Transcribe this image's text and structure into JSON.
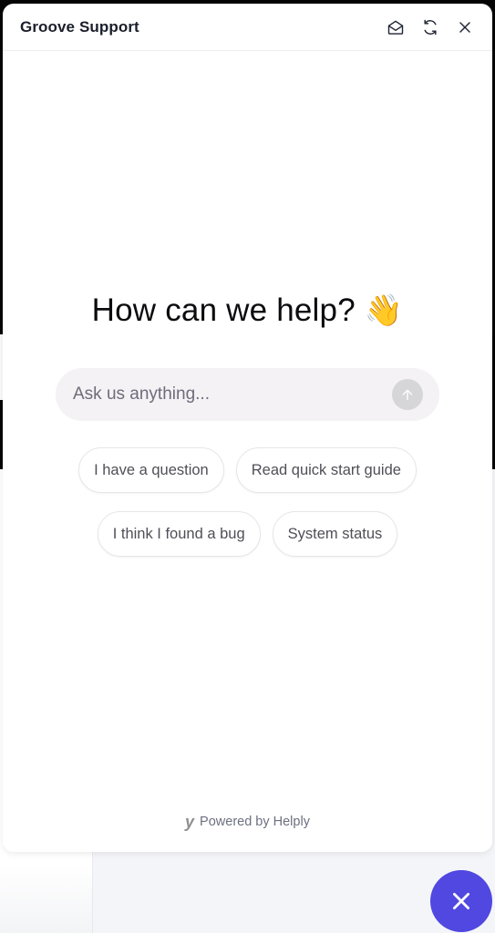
{
  "widget": {
    "title": "Groove Support",
    "header_icons": [
      "envelope-open-icon",
      "refresh-icon",
      "close-icon"
    ]
  },
  "main": {
    "headline": "How can we help?",
    "headline_emoji": "👋",
    "ask": {
      "placeholder": "Ask us anything...",
      "value": "",
      "send_icon": "arrow-up-icon"
    },
    "quick_replies": [
      [
        "I have a question",
        "Read quick start guide"
      ],
      [
        "I think I found a bug",
        "System status"
      ]
    ]
  },
  "footer": {
    "logo_glyph": "y",
    "powered_by": "Powered by Helply"
  },
  "launcher": {
    "icon": "close-icon",
    "color": "#5048e0"
  }
}
